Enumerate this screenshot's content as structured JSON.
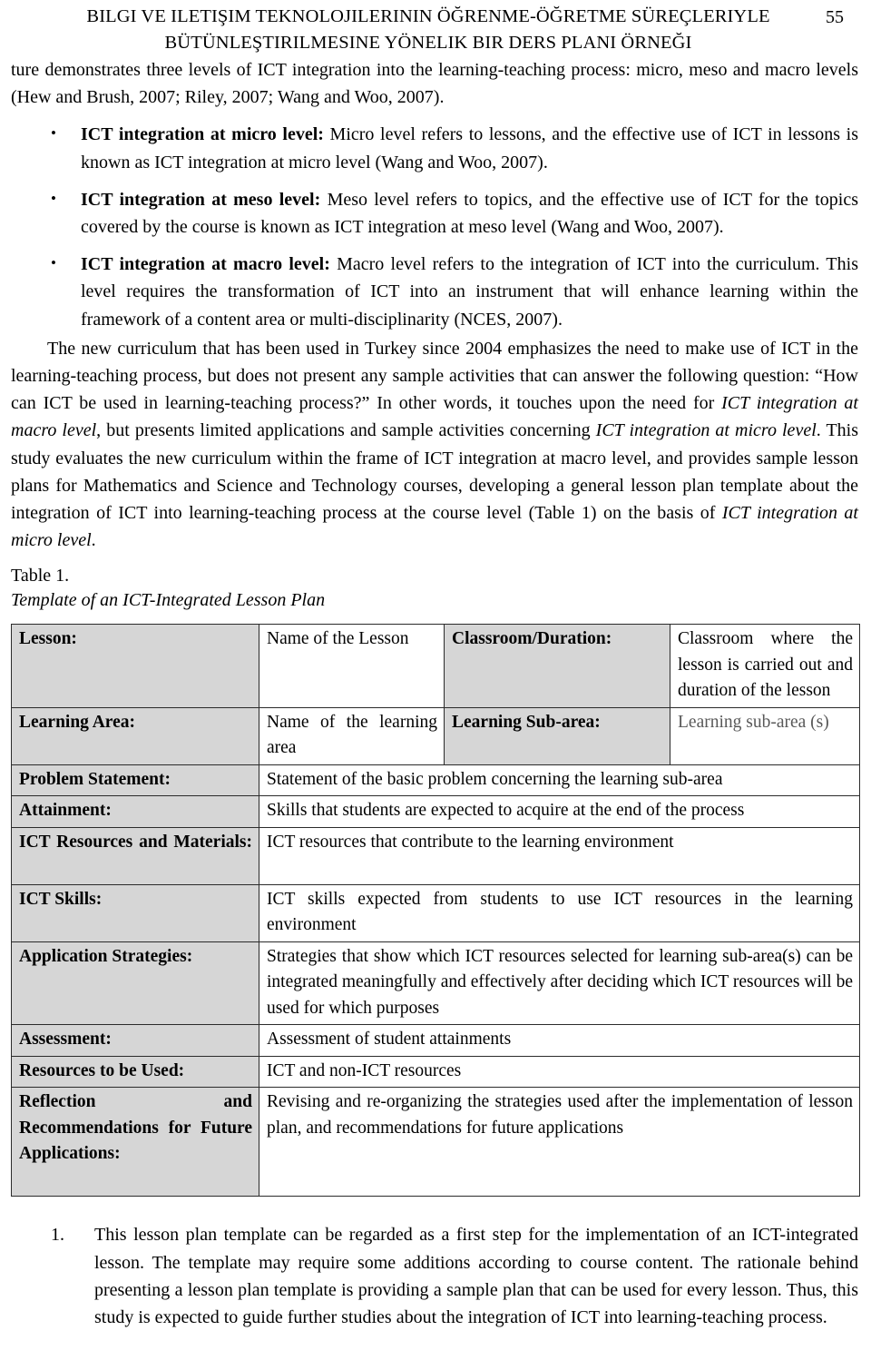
{
  "header": {
    "line1": "BILGI VE ILETIŞIM TEKNOLOJILERININ ÖĞRENME-ÖĞRETME SÜREÇLERIYLE",
    "line2": "BÜTÜNLEŞTIRILMESINE YÖNELIK BIR  DERS PLANI ÖRNEĞI",
    "page_number": "55"
  },
  "body": {
    "continued_paragraph": "ture demonstrates three levels of ICT integration into the learning-teaching process: micro, meso and macro levels (Hew and Brush, 2007; Riley, 2007; Wang and Woo, 2007).",
    "bullets": [
      {
        "lead": "ICT integration at micro level:",
        "text": " Micro level refers to lessons, and the effective use of ICT in lessons is known as ICT integration at micro level (Wang and Woo, 2007)."
      },
      {
        "lead": "ICT integration at meso level:",
        "text": " Meso level refers to topics, and the effective use of ICT for the topics covered by the course is known as ICT integration at meso level (Wang and Woo, 2007)."
      },
      {
        "lead": "ICT integration at macro level:",
        "text": " Macro level refers to the integration of ICT into the curriculum. This level requires the transformation of ICT into an instrument that will enhance learning within the framework of a content area or multi-disciplinarity (NCES, 2007)."
      }
    ],
    "paragraph_parts": {
      "p1": "The new curriculum that has been used in Turkey since 2004 emphasizes the need to make use of ICT in the learning-teaching process, but does not present any sample activities that can answer the following question: “How can ICT be used in learning-teaching process?”  In other words, it touches upon the need for ",
      "p1_italic_a": "ICT integration at macro level",
      "p2": ", but presents limited applications and sample activities concerning ",
      "p2_italic_b": "ICT integration at micro level",
      "p3": ". This study evaluates the new curriculum within the frame of ICT integration at macro level, and provides sample lesson plans for Mathematics and Science and Technology courses, developing a general lesson plan template about the integration of ICT into learning-teaching process at the course level (Table 1) on the basis of ",
      "p3_italic_c": "ICT integration at micro level",
      "p4": "."
    },
    "numbered_items": [
      {
        "number": "1.",
        "text": "This lesson plan template can be regarded as a first step for the implementation of an ICT-integrated lesson. The template may require some additions according to course content. The rationale behind presenting a lesson plan template is providing a sample plan that can be used for every lesson. Thus, this study is expected to guide further studies about the integration of ICT into learning-teaching process."
      }
    ]
  },
  "table": {
    "caption_number": "Table 1.",
    "caption_title": "Template of an ICT-Integrated Lesson Plan",
    "rows": [
      {
        "type": "four-col",
        "label1": "Lesson:",
        "value1": "Name of the Lesson",
        "label2": "Classroom/Duration:",
        "value2": "Classroom where the lesson is carried out and duration of the lesson"
      },
      {
        "type": "four-col",
        "label1": "Learning Area:",
        "value1": "Name of the learning area",
        "label2": "Learning Sub-area:",
        "value2": "Learning sub-area (s)"
      },
      {
        "type": "two-col",
        "label": "Problem Statement:",
        "value": "Statement of the basic problem concerning the learning sub-area"
      },
      {
        "type": "two-col",
        "label": "Attainment:",
        "value": "Skills that students are expected to acquire at the end of the process"
      },
      {
        "type": "two-col",
        "label": "ICT Resources and Materials:",
        "value": "ICT resources that contribute to the learning environment"
      },
      {
        "type": "two-col",
        "label": "ICT Skills:",
        "value": "ICT skills expected from students to use ICT resources in the learning environment"
      },
      {
        "type": "two-col",
        "label": "Application Strategies:",
        "value": "Strategies that show which ICT resources selected for learning sub-area(s) can be integrated meaningfully and effectively after deciding which ICT resources will be used for which purposes"
      },
      {
        "type": "two-col",
        "label": "Assessment:",
        "value": "Assessment of student attainments"
      },
      {
        "type": "two-col",
        "label": "Resources to be Used:",
        "value": "ICT and non-ICT resources"
      },
      {
        "type": "two-col",
        "label": "Reflection and Recommendations for Future Applications:",
        "value": "Revising and re-organizing the strategies used after the implementation of lesson plan, and recommendations for future applications"
      }
    ]
  },
  "colors": {
    "shade": "#d6d6d6",
    "border": "#2b2b2b",
    "text": "#000000",
    "muted_text": "#595959"
  }
}
